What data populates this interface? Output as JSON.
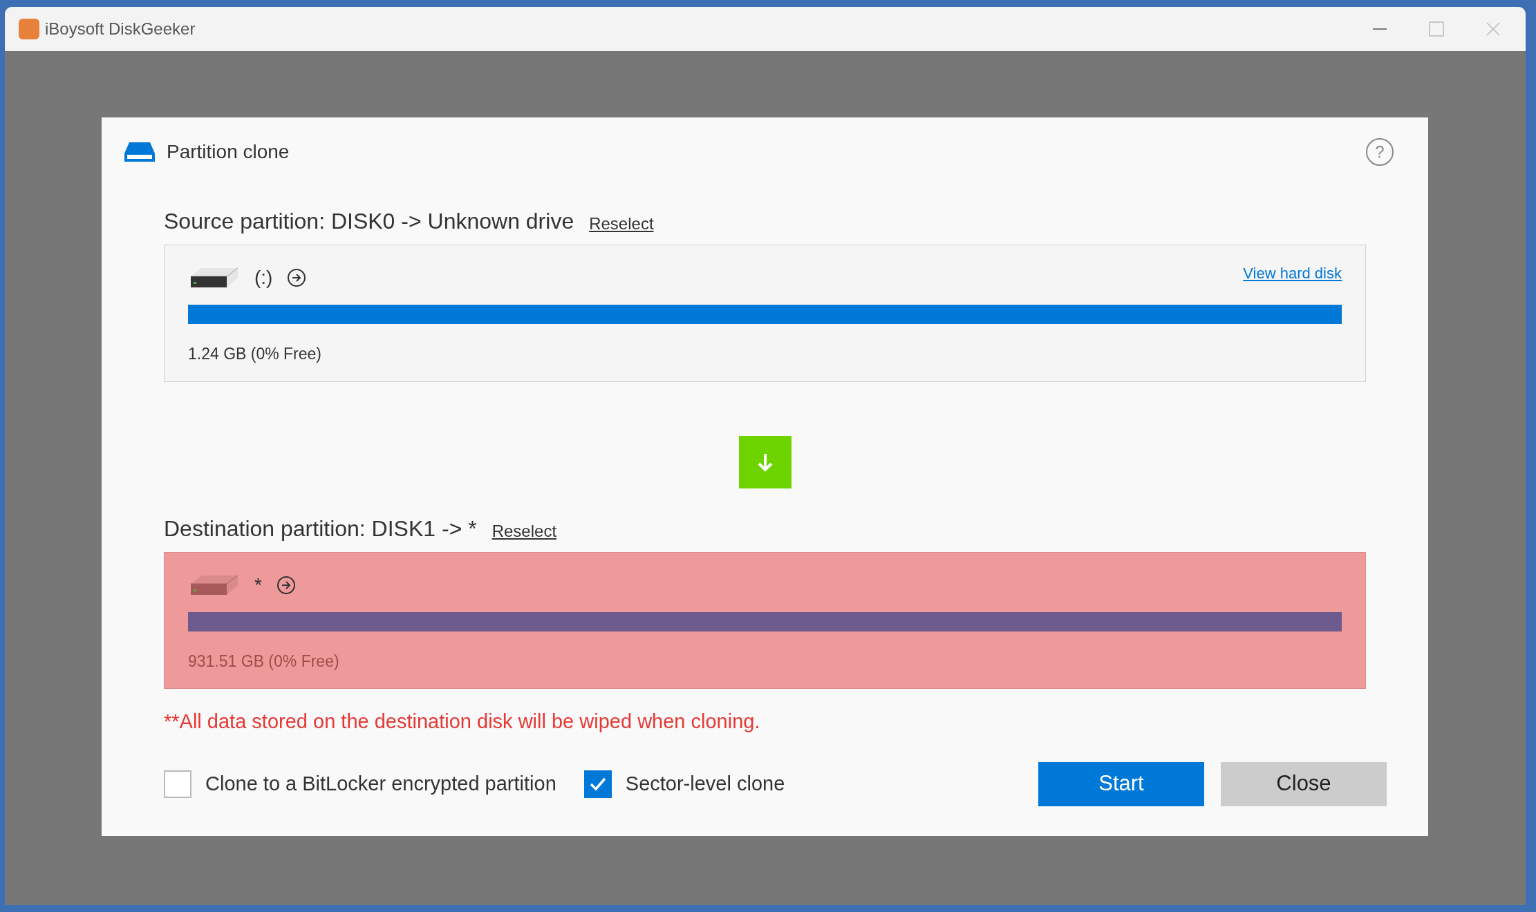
{
  "window": {
    "title": "iBoysoft DiskGeeker"
  },
  "dialog": {
    "title": "Partition clone",
    "help": "?",
    "source": {
      "label": "Source partition: DISK0 -> Unknown drive",
      "reselect": "Reselect",
      "view_link": "View hard disk",
      "name": "(:)",
      "level": 1,
      "size": "1.24 GB (0% Free)"
    },
    "destination": {
      "label": "Destination partition: DISK1 -> *",
      "reselect": "Reselect",
      "name": "*",
      "level": 1,
      "size": "931.51 GB (0% Free)"
    },
    "warning": "**All data stored on the destination disk will be wiped when cloning.",
    "options": [
      {
        "label": "Clone to a BitLocker encrypted partition",
        "checked": false
      },
      {
        "label": "Sector-level clone",
        "checked": true
      }
    ],
    "buttons": [
      {
        "label": "Start",
        "kind": "primary"
      },
      {
        "label": "Close",
        "kind": "secondary"
      }
    ]
  }
}
